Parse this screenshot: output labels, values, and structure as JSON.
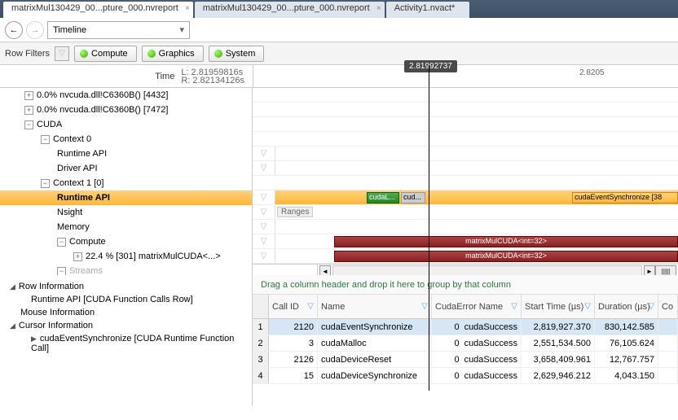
{
  "tabs": [
    {
      "label": "matrixMul130429_00...pture_000.nvreport",
      "active": true
    },
    {
      "label": "matrixMul130429_00...pture_000.nvreport",
      "active": false
    },
    {
      "label": "Activity1.nvact*",
      "active": false
    }
  ],
  "toolbar": {
    "view": "Timeline"
  },
  "filters": {
    "label": "Row Filters",
    "buttons": [
      "Compute",
      "Graphics",
      "System"
    ]
  },
  "time": {
    "label": "Time",
    "L": "L: 2.81959816s",
    "R": "R: 2.82134126s",
    "cursor": "2.81992737",
    "tick": "2.8205"
  },
  "tree": [
    {
      "exp": "+",
      "indent": 1,
      "label": "0.0% nvcuda.dll!C6360B() [4432]"
    },
    {
      "exp": "+",
      "indent": 1,
      "label": "0.0% nvcuda.dll!C6360B() [7472]"
    },
    {
      "exp": "-",
      "indent": 1,
      "label": "CUDA"
    },
    {
      "exp": "-",
      "indent": 2,
      "label": "Context 0"
    },
    {
      "exp": "",
      "indent": 3,
      "label": "Runtime API"
    },
    {
      "exp": "",
      "indent": 3,
      "label": "Driver API"
    },
    {
      "exp": "-",
      "indent": 2,
      "label": "Context 1 [0]"
    },
    {
      "exp": "",
      "indent": 3,
      "label": "Runtime API",
      "hl": true
    },
    {
      "exp": "",
      "indent": 3,
      "label": "Nsight"
    },
    {
      "exp": "",
      "indent": 3,
      "label": "Memory"
    },
    {
      "exp": "-",
      "indent": 3,
      "label": "Compute"
    },
    {
      "exp": "+",
      "indent": 4,
      "label": "22.4 % [301] matrixMulCUDA<...>"
    },
    {
      "exp": "-",
      "indent": 3,
      "label": "Streams"
    }
  ],
  "bars": {
    "cudaL": "cudaL...",
    "cud": "cud...",
    "sync": "cudaEventSynchronize [38",
    "ranges": "Ranges",
    "kernel": "matrixMulCUDA<int=32>"
  },
  "info": {
    "row_info": "Row Information",
    "row_sub": "Runtime API [CUDA Function Calls Row]",
    "mouse": "Mouse Information",
    "cursor": "Cursor Information",
    "cursor_sub": "cudaEventSynchronize [CUDA Runtime Function Call]"
  },
  "grid": {
    "hint": "Drag a column header and drop it here to group by that column",
    "headers": {
      "callid": "Call ID",
      "name": "Name",
      "err": "CudaError Name",
      "start": "Start Time (µs)",
      "dur": "Duration (µs)",
      "co": "Co"
    },
    "rows": [
      {
        "n": "1",
        "id": "2120",
        "name": "cudaEventSynchronize",
        "errn": "0",
        "err": "cudaSuccess",
        "start": "2,819,927.370",
        "dur": "830,142.585",
        "sel": true
      },
      {
        "n": "2",
        "id": "3",
        "name": "cudaMalloc",
        "errn": "0",
        "err": "cudaSuccess",
        "start": "2,551,534.500",
        "dur": "76,105.624"
      },
      {
        "n": "3",
        "id": "2126",
        "name": "cudaDeviceReset",
        "errn": "0",
        "err": "cudaSuccess",
        "start": "3,658,409.961",
        "dur": "12,767.757"
      },
      {
        "n": "4",
        "id": "15",
        "name": "cudaDeviceSynchronize",
        "errn": "0",
        "err": "cudaSuccess",
        "start": "2,629,946.212",
        "dur": "4,043.150"
      }
    ]
  }
}
